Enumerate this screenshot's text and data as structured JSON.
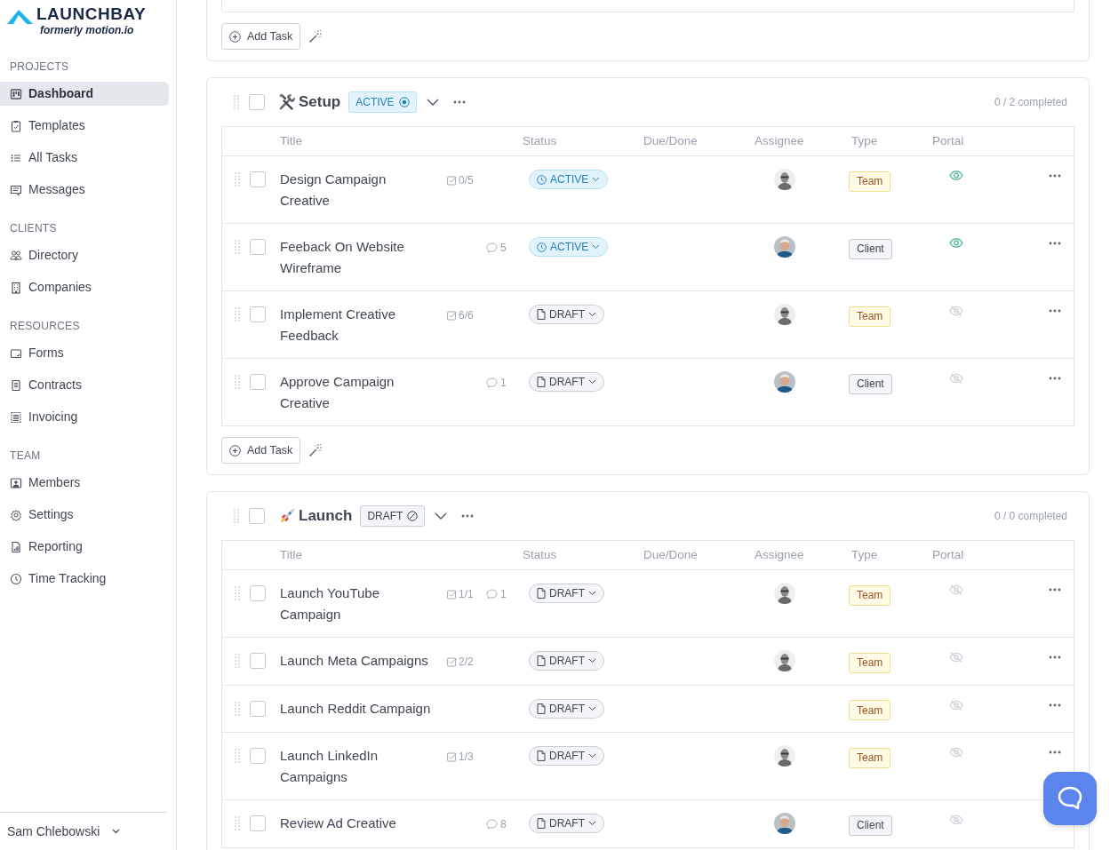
{
  "sidebar": {
    "logo": {
      "name": "LAUNCHBAY",
      "tagline": "formerly motion.io"
    },
    "sections": [
      {
        "heading": "PROJECTS",
        "items": [
          {
            "label": "Dashboard",
            "selected": true
          },
          {
            "label": "Templates",
            "selected": false
          },
          {
            "label": "All Tasks",
            "selected": false
          },
          {
            "label": "Messages",
            "selected": false
          }
        ]
      },
      {
        "heading": "CLIENTS",
        "items": [
          {
            "label": "Directory",
            "selected": false
          },
          {
            "label": "Companies",
            "selected": false
          }
        ]
      },
      {
        "heading": "RESOURCES",
        "items": [
          {
            "label": "Forms",
            "selected": false
          },
          {
            "label": "Contracts",
            "selected": false
          },
          {
            "label": "Invoicing",
            "selected": false
          }
        ]
      },
      {
        "heading": "TEAM",
        "items": [
          {
            "label": "Members",
            "selected": false
          },
          {
            "label": "Settings",
            "selected": false
          },
          {
            "label": "Reporting",
            "selected": false
          },
          {
            "label": "Time Tracking",
            "selected": false
          }
        ]
      }
    ],
    "user": {
      "name": "Sam Chlebowski"
    }
  },
  "top_card": {
    "add_task": "Add Task"
  },
  "groups": [
    {
      "title": "Setup",
      "checked": false,
      "status": {
        "label": "ACTIVE",
        "kind": "active"
      },
      "progress": "0 / 2 completed",
      "add_task": "Add Task",
      "columns": [
        "Title",
        "Status",
        "Due/Done",
        "Assignee",
        "Type",
        "Portal"
      ],
      "tasks": [
        {
          "title": "Design Campaign Creative",
          "checked": false,
          "checklist": "0/5",
          "status": {
            "label": "ACTIVE",
            "kind": "active"
          },
          "assigned": true,
          "photo_colored": false,
          "type": {
            "label": "Team",
            "kind": "team"
          },
          "portal_visible": true
        },
        {
          "title": "Feeback On Website Wireframe",
          "checked": false,
          "comments": "5",
          "status": {
            "label": "ACTIVE",
            "kind": "active"
          },
          "assigned": true,
          "photo_colored": true,
          "type": {
            "label": "Client",
            "kind": "client"
          },
          "portal_visible": true
        },
        {
          "title": "Implement Creative Feedback",
          "checked": false,
          "checklist": "6/6",
          "status": {
            "label": "DRAFT",
            "kind": "draft"
          },
          "assigned": true,
          "photo_colored": false,
          "type": {
            "label": "Team",
            "kind": "team"
          },
          "portal_visible": false
        },
        {
          "title": "Approve Campaign Creative",
          "checked": false,
          "comments": "1",
          "status": {
            "label": "DRAFT",
            "kind": "draft"
          },
          "assigned": true,
          "photo_colored": true,
          "type": {
            "label": "Client",
            "kind": "client"
          },
          "portal_visible": false
        }
      ]
    },
    {
      "title": "Launch",
      "checked": false,
      "status": {
        "label": "DRAFT",
        "kind": "draft"
      },
      "progress": "0 / 0 completed",
      "columns": [
        "Title",
        "Status",
        "Due/Done",
        "Assignee",
        "Type",
        "Portal"
      ],
      "tasks": [
        {
          "title": "Launch YouTube Campaign",
          "checked": false,
          "checklist": "1/1",
          "comments": "1",
          "status": {
            "label": "DRAFT",
            "kind": "draft"
          },
          "assigned": true,
          "photo_colored": false,
          "type": {
            "label": "Team",
            "kind": "team"
          },
          "portal_visible": false
        },
        {
          "title": "Launch Meta Campaigns",
          "checked": false,
          "checklist": "2/2",
          "status": {
            "label": "DRAFT",
            "kind": "draft"
          },
          "assigned": true,
          "photo_colored": false,
          "type": {
            "label": "Team",
            "kind": "team"
          },
          "portal_visible": false
        },
        {
          "title": "Launch Reddit Campaign",
          "checked": false,
          "status": {
            "label": "DRAFT",
            "kind": "draft"
          },
          "assigned": false,
          "type": {
            "label": "Team",
            "kind": "team"
          },
          "portal_visible": false
        },
        {
          "title": "Launch LinkedIn Campaigns",
          "checked": false,
          "checklist": "1/3",
          "status": {
            "label": "DRAFT",
            "kind": "draft"
          },
          "assigned": true,
          "photo_colored": false,
          "type": {
            "label": "Team",
            "kind": "team"
          },
          "portal_visible": false
        },
        {
          "title": "Review Ad Creative",
          "checked": false,
          "comments": "8",
          "status": {
            "label": "DRAFT",
            "kind": "draft"
          },
          "assigned": true,
          "photo_colored": true,
          "type": {
            "label": "Client",
            "kind": "client"
          },
          "portal_visible": false
        }
      ]
    }
  ]
}
